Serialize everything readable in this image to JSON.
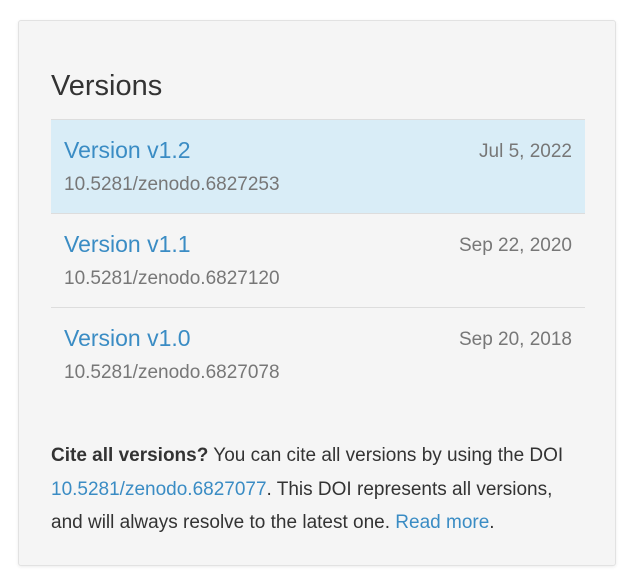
{
  "versions": {
    "title": "Versions",
    "items": [
      {
        "label": "Version v1.2",
        "date": "Jul 5, 2022",
        "doi": "10.5281/zenodo.6827253",
        "active": true
      },
      {
        "label": "Version v1.1",
        "date": "Sep 22, 2020",
        "doi": "10.5281/zenodo.6827120",
        "active": false
      },
      {
        "label": "Version v1.0",
        "date": "Sep 20, 2018",
        "doi": "10.5281/zenodo.6827078",
        "active": false
      }
    ]
  },
  "cite": {
    "heading": "Cite all versions?",
    "text1": " You can cite all versions by using the DOI ",
    "doi": "10.5281/zenodo.6827077",
    "text2": ". This DOI represents all versions, and will always resolve to the latest one. ",
    "read_more": "Read more",
    "end": "."
  },
  "colors": {
    "link": "#3a8cc4",
    "active_row_bg": "#d9edf7",
    "panel_bg": "#f5f5f5",
    "muted_text": "#777777"
  }
}
